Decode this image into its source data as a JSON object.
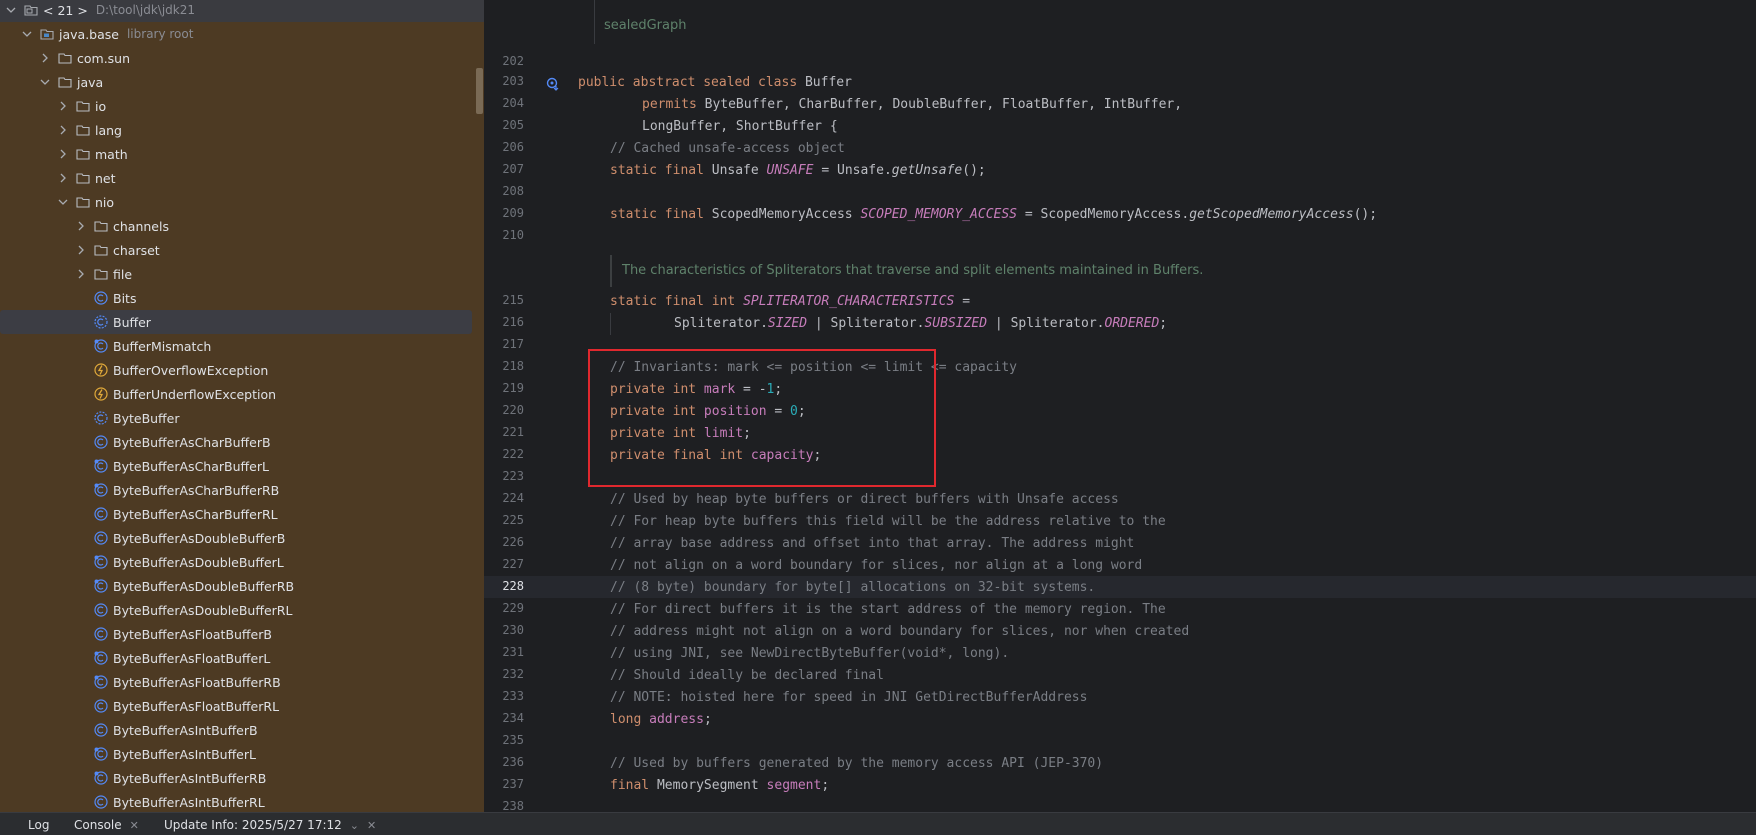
{
  "tree": {
    "header": {
      "label": "< 21 >",
      "path": "D:\\tool\\jdk\\jdk21"
    },
    "items": [
      {
        "label": "java.base",
        "hint": "library root"
      },
      {
        "label": "com.sun"
      },
      {
        "label": "java"
      },
      {
        "label": "io"
      },
      {
        "label": "lang"
      },
      {
        "label": "math"
      },
      {
        "label": "net"
      },
      {
        "label": "nio"
      },
      {
        "label": "channels"
      },
      {
        "label": "charset"
      },
      {
        "label": "file"
      },
      {
        "label": "Bits"
      },
      {
        "label": "Buffer"
      },
      {
        "label": "BufferMismatch"
      },
      {
        "label": "BufferOverflowException"
      },
      {
        "label": "BufferUnderflowException"
      },
      {
        "label": "ByteBuffer"
      },
      {
        "label": "ByteBufferAsCharBufferB"
      },
      {
        "label": "ByteBufferAsCharBufferL"
      },
      {
        "label": "ByteBufferAsCharBufferRB"
      },
      {
        "label": "ByteBufferAsCharBufferRL"
      },
      {
        "label": "ByteBufferAsDoubleBufferB"
      },
      {
        "label": "ByteBufferAsDoubleBufferL"
      },
      {
        "label": "ByteBufferAsDoubleBufferRB"
      },
      {
        "label": "ByteBufferAsDoubleBufferRL"
      },
      {
        "label": "ByteBufferAsFloatBufferB"
      },
      {
        "label": "ByteBufferAsFloatBufferL"
      },
      {
        "label": "ByteBufferAsFloatBufferRB"
      },
      {
        "label": "ByteBufferAsFloatBufferRL"
      },
      {
        "label": "ByteBufferAsIntBufferB"
      },
      {
        "label": "ByteBufferAsIntBufferL"
      },
      {
        "label": "ByteBufferAsIntBufferRB"
      },
      {
        "label": "ByteBufferAsIntBufferRL"
      }
    ]
  },
  "editor": {
    "docs": {
      "sealed": "sealedGraph",
      "spliterator": "The characteristics of Spliterators that traverse and split elements maintained in Buffers."
    },
    "line_numbers": [
      "202",
      "203",
      "204",
      "205",
      "206",
      "207",
      "208",
      "209",
      "210",
      "215",
      "216",
      "217",
      "218",
      "219",
      "220",
      "221",
      "222",
      "223",
      "224",
      "225",
      "226",
      "227",
      "228",
      "229",
      "230",
      "231",
      "232",
      "233",
      "234",
      "235",
      "236",
      "237",
      "238"
    ],
    "current_line": "228",
    "code": {
      "l203_kw": "public abstract sealed class",
      "l203_name": " Buffer",
      "l204_kw": "permits",
      "l204_rest": " ByteBuffer, CharBuffer, DoubleBuffer, FloatBuffer, IntBuffer,",
      "l205": "LongBuffer, ShortBuffer {",
      "l206": "// Cached unsafe-access object",
      "l207_kw": "static final",
      "l207_type": " Unsafe ",
      "l207_field": "UNSAFE",
      "l207_mid": " = Unsafe.",
      "l207_method": "getUnsafe",
      "l207_end": "();",
      "l209_kw": "static final",
      "l209_type": " ScopedMemoryAccess ",
      "l209_field": "SCOPED_MEMORY_ACCESS",
      "l209_mid": " = ScopedMemoryAccess.",
      "l209_method": "getScopedMemoryAccess",
      "l209_end": "();",
      "l215_kw": "static final int",
      "l215_field": "SPLITERATOR_CHARACTERISTICS",
      "l215_end": " =",
      "l216_a": "Spliterator.",
      "l216_b": "SIZED",
      "l216_c": " | Spliterator.",
      "l216_d": "SUBSIZED",
      "l216_e": " | Spliterator.",
      "l216_f": "ORDERED",
      "l216_g": ";",
      "l218": "// Invariants: mark <= position <= limit <= capacity",
      "l219_kw": "private int",
      "l219_field": "mark",
      "l219_mid": " = -",
      "l219_num": "1",
      "l219_end": ";",
      "l220_kw": "private int",
      "l220_field": "position",
      "l220_mid": " = ",
      "l220_num": "0",
      "l220_end": ";",
      "l221_kw": "private int",
      "l221_field": "limit",
      "l221_end": ";",
      "l222_kw": "private final int",
      "l222_field": "capacity",
      "l222_end": ";",
      "l224": "// Used by heap byte buffers or direct buffers with Unsafe access",
      "l225": "// For heap byte buffers this field will be the address relative to the",
      "l226": "// array base address and offset into that array. The address might",
      "l227": "// not align on a word boundary for slices, nor align at a long word",
      "l228": "// (8 byte) boundary for byte[] allocations on 32-bit systems.",
      "l229": "// For direct buffers it is the start address of the memory region. The",
      "l230": "// address might not align on a word boundary for slices, nor when created",
      "l231": "// using JNI, see NewDirectByteBuffer(void*, long).",
      "l232": "// Should ideally be declared final",
      "l233": "// NOTE: hoisted here for speed in JNI GetDirectBufferAddress",
      "l234_kw": "long",
      "l234_field": "address",
      "l234_end": ";",
      "l236": "// Used by buffers generated by the memory access API (JEP-370)",
      "l237_kw": "final",
      "l237_type": " MemorySegment ",
      "l237_field": "segment",
      "l237_end": ";"
    }
  },
  "bottombar": {
    "tabs": [
      "Log",
      "Console",
      "Update Info: 2025/5/27 17:12"
    ]
  },
  "colors": {
    "tree_bg": "#4d3a23",
    "editor_bg": "#1e1f22",
    "highlight_border": "#e0282e",
    "keyword": "#cf8e6d",
    "field": "#c77dbb",
    "comment": "#7a7e85",
    "number": "#2aacb8",
    "doc": "#5f826b"
  }
}
